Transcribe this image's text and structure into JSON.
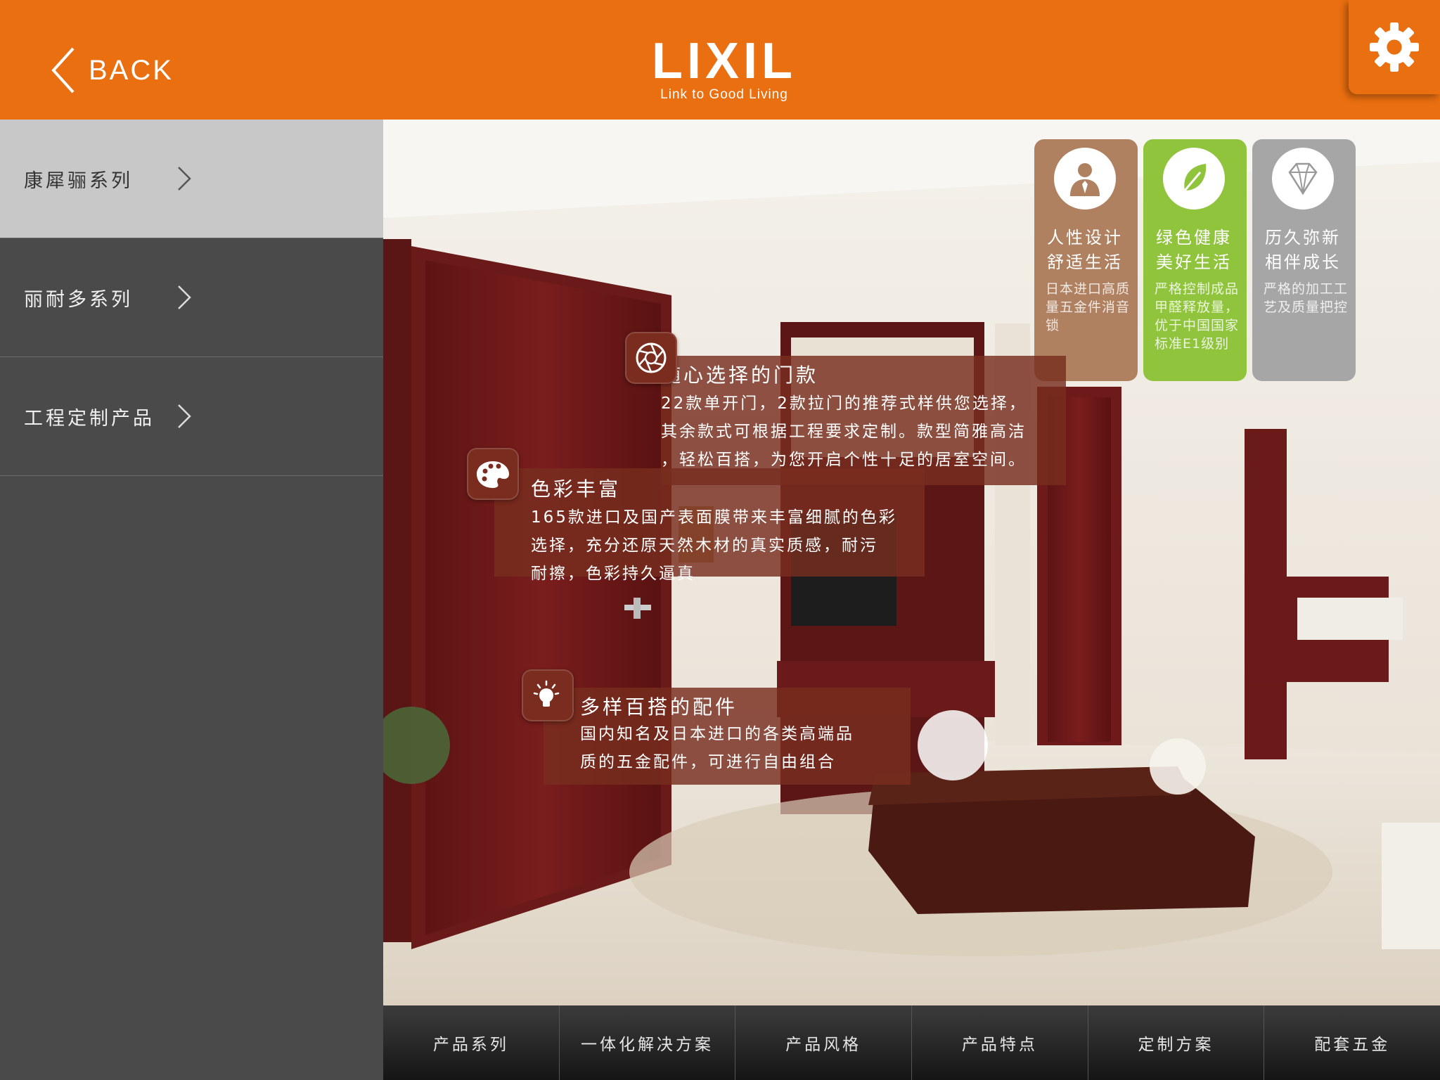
{
  "header": {
    "back_label": "BACK",
    "logo_text": "LIXIL",
    "logo_tagline": "Link to Good Living",
    "accent_color": "#ea6f10"
  },
  "sidebar": {
    "items": [
      {
        "label": "康犀骊系列",
        "active": true
      },
      {
        "label": "丽耐多系列",
        "active": false
      },
      {
        "label": "工程定制产品",
        "active": false
      }
    ]
  },
  "cards": [
    {
      "icon": "person-tie-icon",
      "title1": "人性设计",
      "title2": "舒适生活",
      "desc": "日本进口高质量五金件消音锁",
      "color": "#b08160"
    },
    {
      "icon": "leaf-icon",
      "title1": "绿色健康",
      "title2": "美好生活",
      "desc": "严格控制成品甲醛释放量，优于中国国家标准E1级别",
      "color": "#8fc43c"
    },
    {
      "icon": "diamond-icon",
      "title1": "历久弥新",
      "title2": "相伴成长",
      "desc": "严格的加工工艺及质量把控",
      "color": "#a6a6a6"
    }
  ],
  "features": [
    {
      "icon": "aperture-icon",
      "title": "随心选择的门款",
      "lines": [
        "22款单开门，2款拉门的推荐式样供您选择，",
        "其余款式可根据工程要求定制。款型简雅高洁",
        "，轻松百搭，为您开启个性十足的居室空间。"
      ]
    },
    {
      "icon": "palette-icon",
      "title": "色彩丰富",
      "lines": [
        "165款进口及国产表面膜带来丰富细腻的色彩",
        "选择，充分还原天然木材的真实质感，耐污",
        "耐擦，色彩持久逼真"
      ]
    },
    {
      "icon": "lightbulb-icon",
      "title": "多样百搭的配件",
      "lines": [
        "国内知名及日本进口的各类高端品",
        "质的五金配件，可进行自由组合"
      ]
    }
  ],
  "bottom_tabs": [
    "产品系列",
    "一体化解决方案",
    "产品风格",
    "产品特点",
    "定制方案",
    "配套五金"
  ]
}
